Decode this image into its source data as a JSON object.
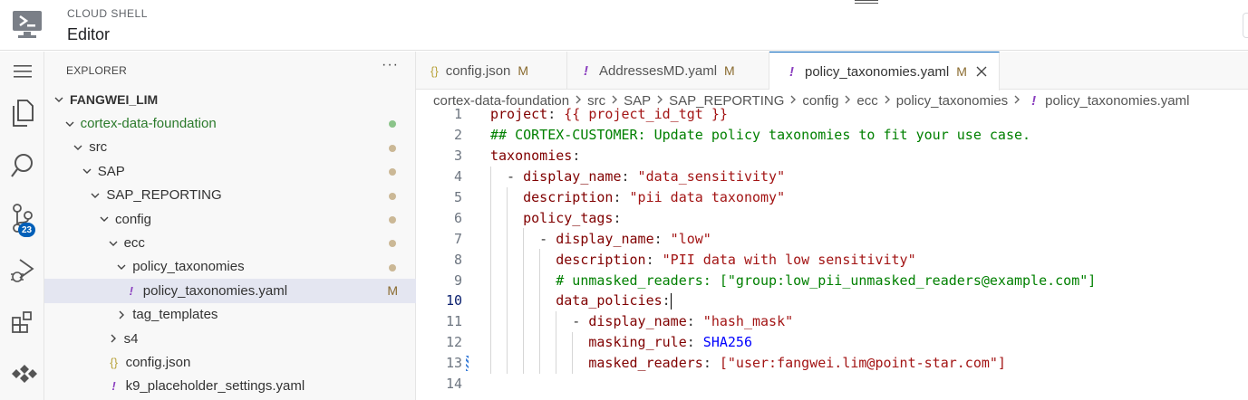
{
  "header": {
    "brand": "CLOUD SHELL",
    "product": "Editor"
  },
  "activity_bar": {
    "items": [
      "menu-icon",
      "explorer-icon",
      "search-icon",
      "source-control-icon",
      "run-debug-icon",
      "extensions-icon",
      "cloud-code-icon"
    ],
    "source_control_badge": "23"
  },
  "sidebar": {
    "title": "EXPLORER",
    "more": "···",
    "tree": [
      {
        "label": "FANGWEI_LIM",
        "depth": 0,
        "type": "folder",
        "open": true
      },
      {
        "label": "cortex-data-foundation",
        "depth": 1,
        "type": "folder",
        "open": true
      },
      {
        "label": "src",
        "depth": 2,
        "type": "folder",
        "open": true
      },
      {
        "label": "SAP",
        "depth": 3,
        "type": "folder",
        "open": true
      },
      {
        "label": "SAP_REPORTING",
        "depth": 4,
        "type": "folder",
        "open": true
      },
      {
        "label": "config",
        "depth": 5,
        "type": "folder",
        "open": true
      },
      {
        "label": "ecc",
        "depth": 6,
        "type": "folder",
        "open": true
      },
      {
        "label": "policy_taxonomies",
        "depth": 7,
        "type": "folder",
        "open": true
      },
      {
        "label": "policy_taxonomies.yaml",
        "depth": 8,
        "type": "yaml",
        "status": "M"
      },
      {
        "label": "tag_templates",
        "depth": 7,
        "type": "folder",
        "open": false
      },
      {
        "label": "s4",
        "depth": 6,
        "type": "folder",
        "open": false
      },
      {
        "label": "config.json",
        "depth": 6,
        "type": "json"
      },
      {
        "label": "k9_placeholder_settings.yaml",
        "depth": 6,
        "type": "yaml"
      }
    ]
  },
  "tabs": [
    {
      "label": "config.json",
      "status": "M",
      "icon": "{}"
    },
    {
      "label": "AddressesMD.yaml",
      "status": "M",
      "icon": "!"
    },
    {
      "label": "policy_taxonomies.yaml",
      "status": "M",
      "icon": "!",
      "active": true
    }
  ],
  "breadcrumb": [
    "cortex-data-foundation",
    "src",
    "SAP",
    "SAP_REPORTING",
    "config",
    "ecc",
    "policy_taxonomies",
    "policy_taxonomies.yaml"
  ],
  "editor": {
    "current_line": 10,
    "lines": [
      {
        "n": "1",
        "text": "project: {{ project_id_tgt }}"
      },
      {
        "n": "2",
        "text": "## CORTEX-CUSTOMER: Update policy taxonomies to fit your use case."
      },
      {
        "n": "3",
        "text": "taxonomies:"
      },
      {
        "n": "4",
        "text": "  - display_name: \"data_sensitivity\""
      },
      {
        "n": "5",
        "text": "    description: \"pii data taxonomy\""
      },
      {
        "n": "6",
        "text": "    policy_tags:"
      },
      {
        "n": "7",
        "text": "      - display_name: \"low\""
      },
      {
        "n": "8",
        "text": "        description: \"PII data with low sensitivity\""
      },
      {
        "n": "9",
        "text": "        # unmasked_readers: [\"group:low_pii_unmasked_readers@example.com\"]"
      },
      {
        "n": "10",
        "text": "        data_policies:"
      },
      {
        "n": "11",
        "text": "          - display_name: \"hash_mask\""
      },
      {
        "n": "12",
        "text": "            masking_rule: SHA256"
      },
      {
        "n": "13",
        "text": "            masked_readers: [\"user:fangwei.lim@point-star.com\"]"
      },
      {
        "n": "14",
        "text": ""
      }
    ]
  }
}
